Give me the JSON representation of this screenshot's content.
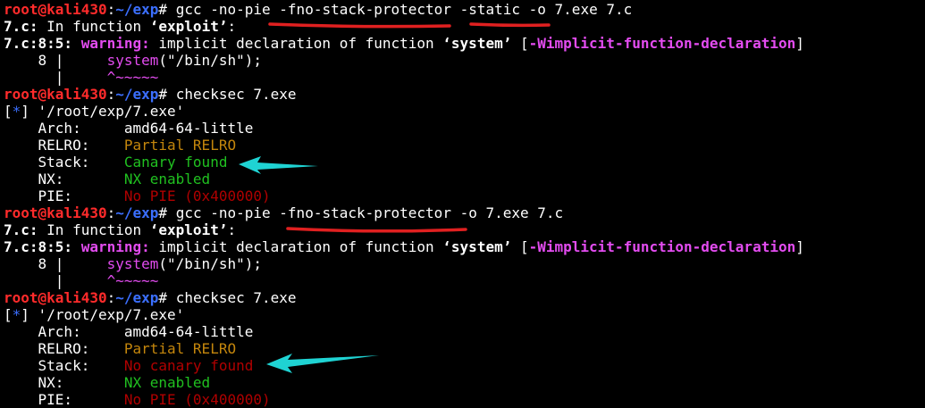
{
  "prompt": {
    "user": "root",
    "at": "@",
    "host": "kali430",
    "sep": ":",
    "path": "~/exp",
    "hash": "#"
  },
  "block1": {
    "cmd": " gcc -no-pie -fno-stack-protector -static -o 7.exe 7.c",
    "fn_prefix": "7.c:",
    "fn_text": " In function ",
    "fn_name": "‘exploit’",
    "fn_colon": ":",
    "warn_loc": "7.c:8:5:",
    "warn_word": " warning:",
    "warn_text": " implicit declaration of function ",
    "warn_fn": "‘system’",
    "warn_open": " [",
    "warn_flag": "-Wimplicit-function-declaration",
    "warn_close": "]",
    "code_lineno": "    8 |     ",
    "code_call": "system",
    "code_args": "(\"/bin/sh\");",
    "code_bar": "      |     ",
    "code_caret": "^~~~~~",
    "checksec_cmd": " checksec 7.exe",
    "star_open": "[",
    "star": "*",
    "star_close": "]",
    "file": " '/root/exp/7.exe'",
    "rows": [
      {
        "label": "    Arch:     ",
        "value": "amd64-64-little"
      },
      {
        "label": "    RELRO:    ",
        "value": "Partial RELRO"
      },
      {
        "label": "    Stack:    ",
        "value": "Canary found"
      },
      {
        "label": "    NX:       ",
        "value": "NX enabled"
      },
      {
        "label": "    PIE:      ",
        "value": "No PIE (0x400000)"
      }
    ]
  },
  "block2": {
    "cmd": " gcc -no-pie -fno-stack-protector -o 7.exe 7.c",
    "fn_prefix": "7.c:",
    "fn_text": " In function ",
    "fn_name": "‘exploit’",
    "fn_colon": ":",
    "warn_loc": "7.c:8:5:",
    "warn_word": " warning:",
    "warn_text": " implicit declaration of function ",
    "warn_fn": "‘system’",
    "warn_open": " [",
    "warn_flag": "-Wimplicit-function-declaration",
    "warn_close": "]",
    "code_lineno": "    8 |     ",
    "code_call": "system",
    "code_args": "(\"/bin/sh\");",
    "code_bar": "      |     ",
    "code_caret": "^~~~~~",
    "checksec_cmd": " checksec 7.exe",
    "star_open": "[",
    "star": "*",
    "star_close": "]",
    "file": " '/root/exp/7.exe'",
    "rows": [
      {
        "label": "    Arch:     ",
        "value": "amd64-64-little"
      },
      {
        "label": "    RELRO:    ",
        "value": "Partial RELRO"
      },
      {
        "label": "    Stack:    ",
        "value": "No canary found"
      },
      {
        "label": "    NX:       ",
        "value": "NX enabled"
      },
      {
        "label": "    PIE:      ",
        "value": "No PIE (0x400000)"
      }
    ]
  },
  "annotations": {
    "underline_color": "#e02020",
    "arrow_color": "#1fd3d3"
  },
  "colors": {
    "background": "#000000",
    "prompt_red": "#ff2b2b",
    "path_blue": "#3b6fff",
    "warning_magenta": "#e34cf0",
    "relro_yellow": "#c4860c",
    "enabled_green": "#20c020",
    "disabled_red": "#b00000"
  }
}
